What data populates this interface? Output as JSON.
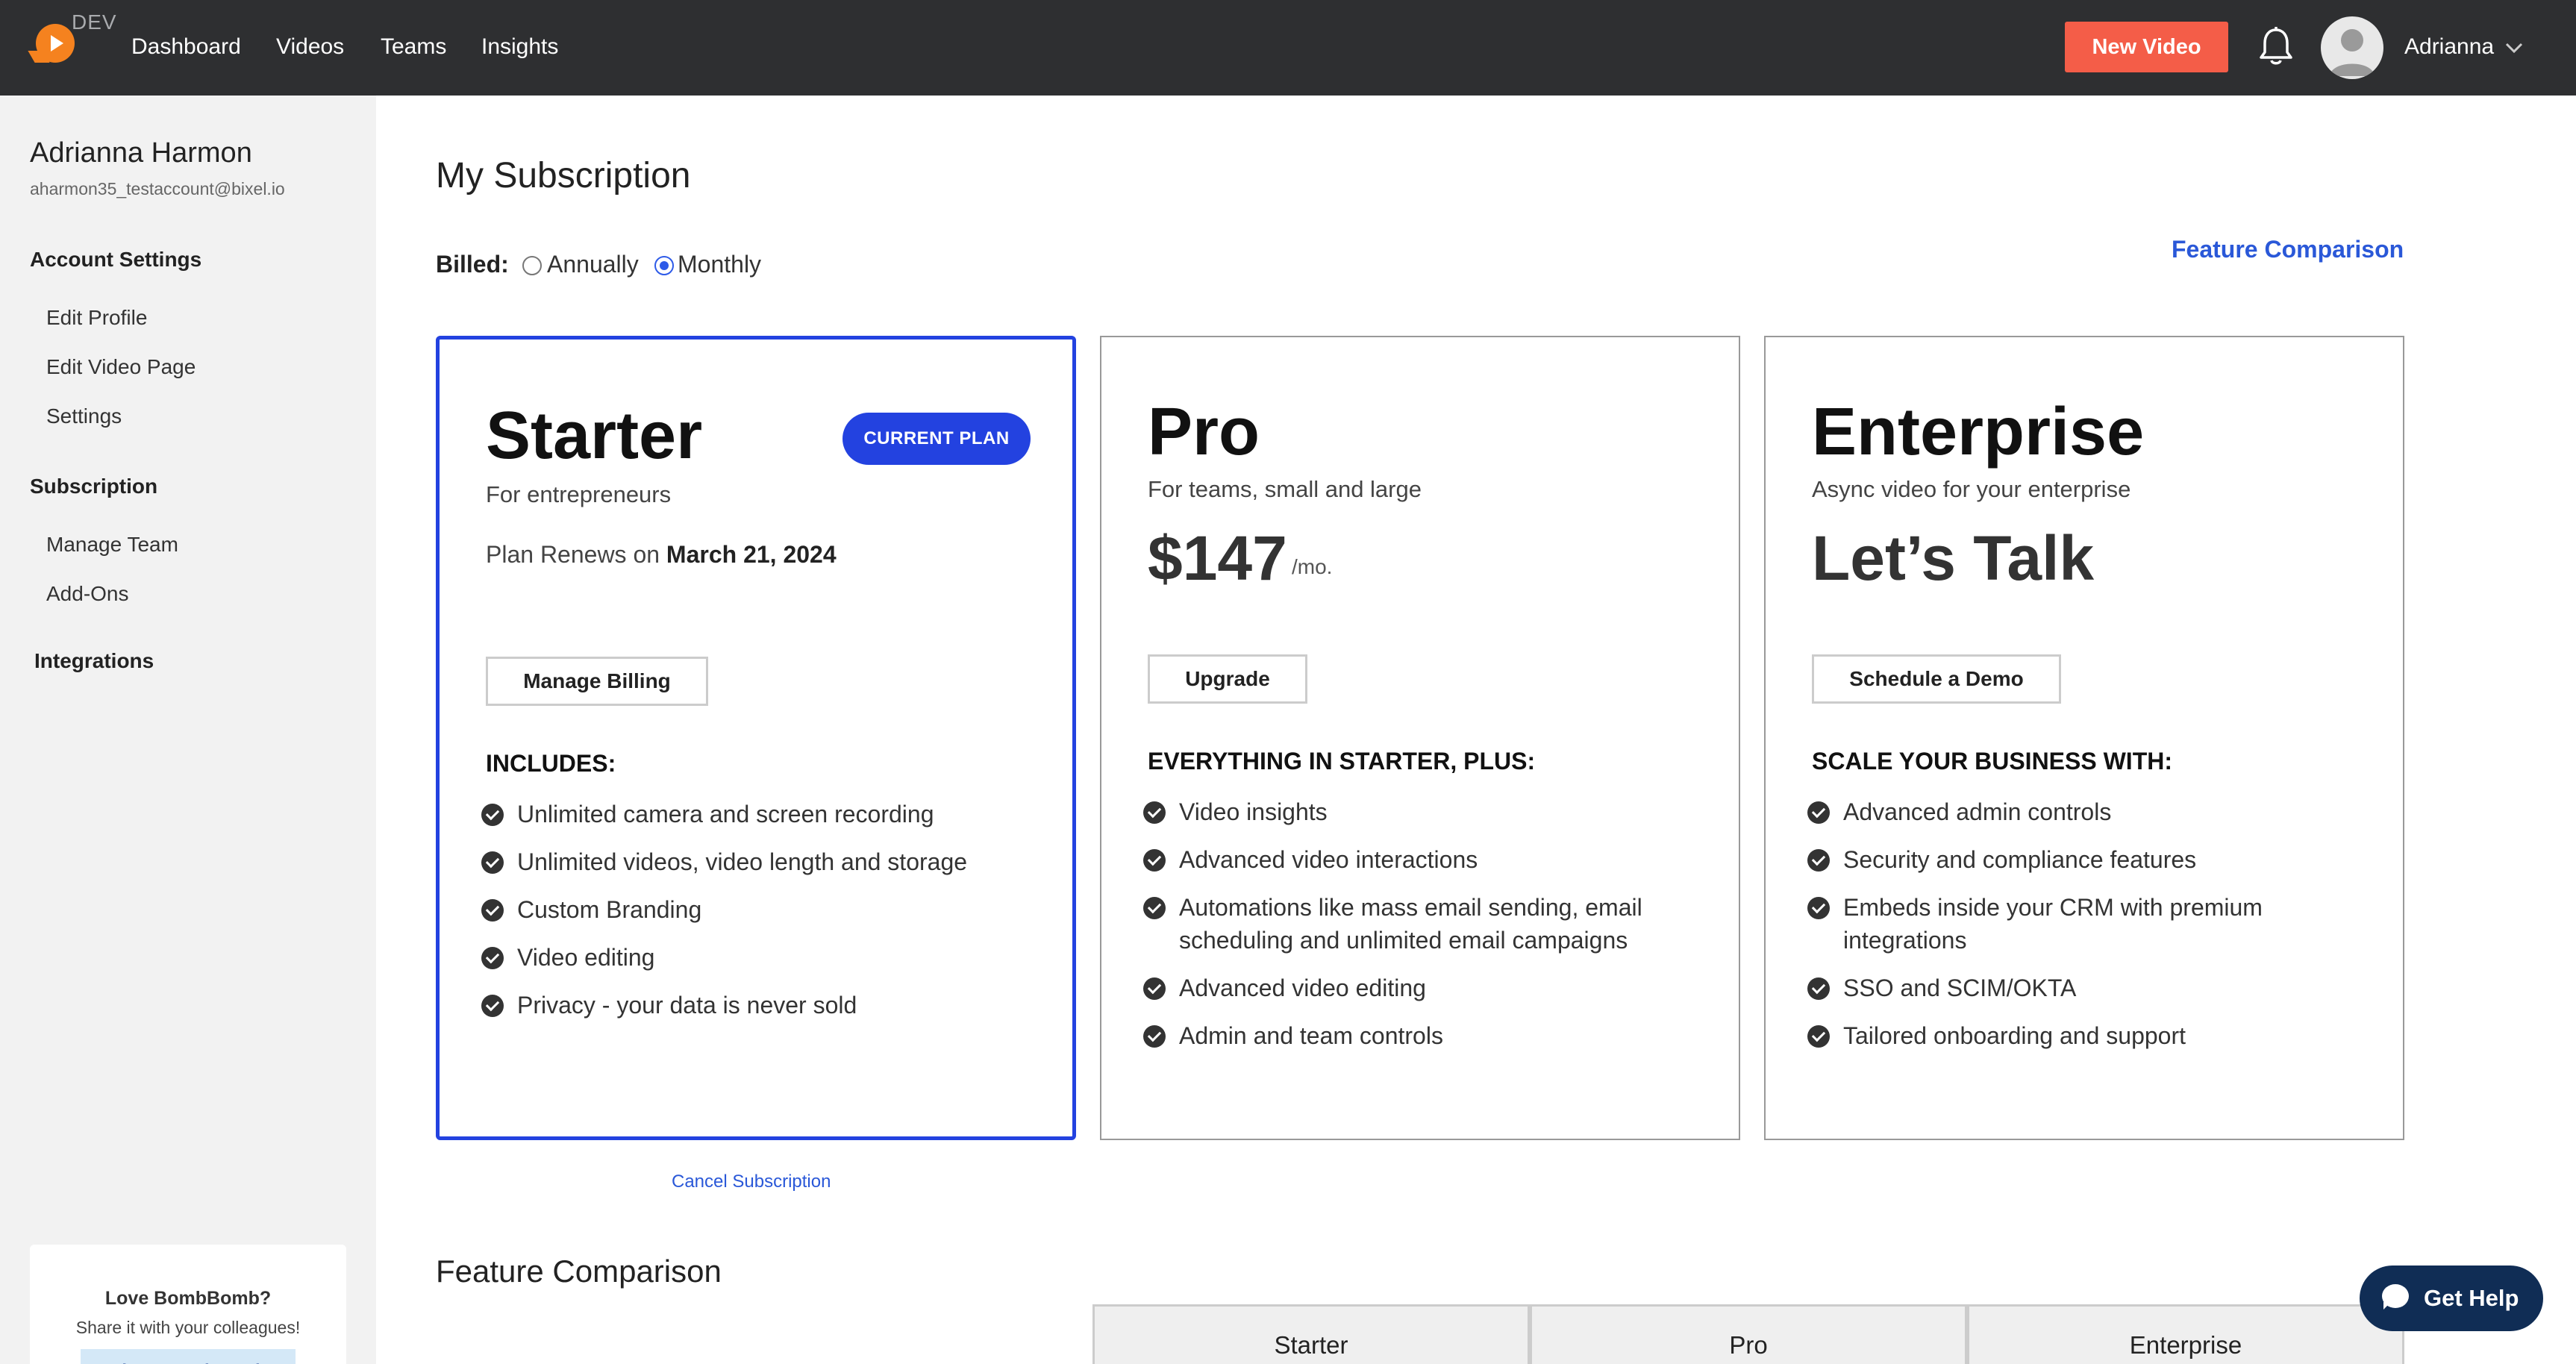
{
  "header": {
    "env_badge": "DEV",
    "nav": [
      "Dashboard",
      "Videos",
      "Teams",
      "Insights"
    ],
    "new_video": "New Video",
    "user_name": "Adrianna"
  },
  "sidebar": {
    "name": "Adrianna Harmon",
    "email": "aharmon35_testaccount@bixel.io",
    "sections": [
      {
        "title": "Account Settings",
        "items": [
          "Edit Profile",
          "Edit Video Page",
          "Settings"
        ]
      },
      {
        "title": "Subscription",
        "items": [
          "Manage Team",
          "Add-Ons"
        ]
      },
      {
        "title": "Integrations",
        "items": []
      }
    ],
    "promo": {
      "title": "Love BombBomb?",
      "subtitle": "Share it with your colleagues!",
      "button": "Share BombBomb"
    }
  },
  "main": {
    "title": "My Subscription",
    "billed_label": "Billed:",
    "billing_options": [
      {
        "label": "Annually",
        "selected": false
      },
      {
        "label": "Monthly",
        "selected": true
      }
    ],
    "feature_comparison_link": "Feature Comparison",
    "plans": [
      {
        "name": "Starter",
        "subtitle": "For entrepreneurs",
        "badge": "CURRENT PLAN",
        "renews_prefix": "Plan Renews on",
        "renews_date": "March 21, 2024",
        "button": "Manage Billing",
        "includes_title": "INCLUDES:",
        "features": [
          "Unlimited camera and screen recording",
          "Unlimited videos, video length and storage",
          "Custom Branding",
          "Video editing",
          "Privacy - your data is never sold"
        ]
      },
      {
        "name": "Pro",
        "subtitle": "For teams, small and large",
        "price": "$147",
        "price_unit": "/mo.",
        "button": "Upgrade",
        "includes_title": "EVERYTHING IN STARTER, PLUS:",
        "features": [
          "Video insights",
          "Advanced video interactions",
          "Automations like mass email sending, email scheduling and unlimited email campaigns",
          "Advanced video editing",
          "Admin and team controls"
        ]
      },
      {
        "name": "Enterprise",
        "subtitle": "Async video for your enterprise",
        "price_text": "Let’s Talk",
        "button": "Schedule a Demo",
        "includes_title": "SCALE YOUR BUSINESS WITH:",
        "features": [
          "Advanced admin controls",
          "Security and compliance features",
          "Embeds inside your CRM with premium integrations",
          "SSO and SCIM/OKTA",
          "Tailored onboarding and support"
        ]
      }
    ],
    "cancel_link": "Cancel Subscription",
    "comparison_title": "Feature Comparison",
    "comparison_columns": [
      "Starter",
      "Pro",
      "Enterprise"
    ]
  },
  "help": {
    "label": "Get Help"
  },
  "colors": {
    "accent_blue": "#2342e0",
    "new_video_red": "#f45d48",
    "topbar": "#2e2f31",
    "help_navy": "#102d55"
  },
  "icons": [
    "logo-icon",
    "bell-icon",
    "avatar-icon",
    "chevron-down-icon",
    "check-icon",
    "chat-bubble-icon"
  ]
}
